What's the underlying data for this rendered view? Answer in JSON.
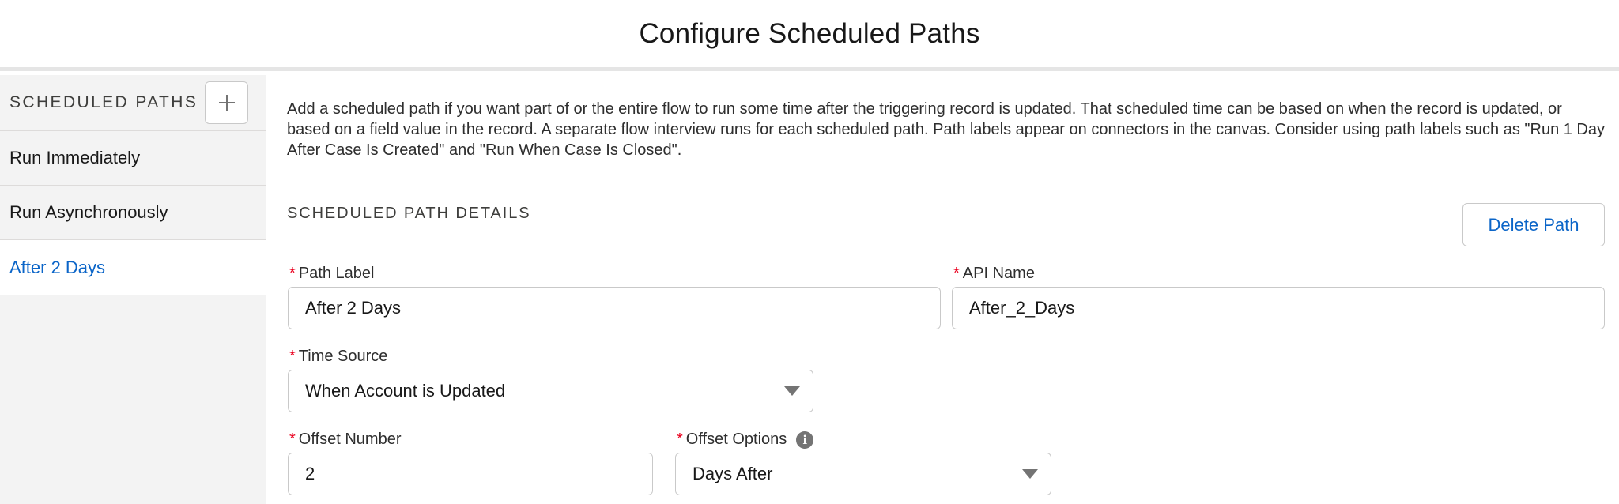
{
  "page": {
    "title": "Configure Scheduled Paths"
  },
  "sidebar": {
    "heading": "SCHEDULED PATHS",
    "add_icon": "plus-icon",
    "items": [
      {
        "label": "Run Immediately",
        "active": false
      },
      {
        "label": "Run Asynchronously",
        "active": false
      },
      {
        "label": "After 2 Days",
        "active": true
      }
    ]
  },
  "main": {
    "description": "Add a scheduled path if you want part of or the entire flow to run some time after the triggering record is updated. That scheduled time can be based on when the record is updated, or based on a field value in the record. A separate flow interview runs for each scheduled path. Path labels appear on connectors in the canvas. Consider using path labels such as \"Run 1 Day After Case Is Created\" and \"Run When Case Is Closed\".",
    "section_title": "SCHEDULED PATH DETAILS",
    "delete_label": "Delete Path",
    "required_marker": "*",
    "fields": {
      "path_label": {
        "label": "Path Label",
        "value": "After 2 Days"
      },
      "api_name": {
        "label": "API Name",
        "value": "After_2_Days"
      },
      "time_source": {
        "label": "Time Source",
        "value": "When Account is Updated"
      },
      "offset_number": {
        "label": "Offset Number",
        "value": "2"
      },
      "offset_options": {
        "label": "Offset Options",
        "value": "Days After",
        "info_icon": "info-icon"
      }
    }
  },
  "colors": {
    "accent": "#0b65c8",
    "required": "#ea001e",
    "sidebar_bg": "#f3f3f3",
    "border": "#c9c9c9"
  }
}
